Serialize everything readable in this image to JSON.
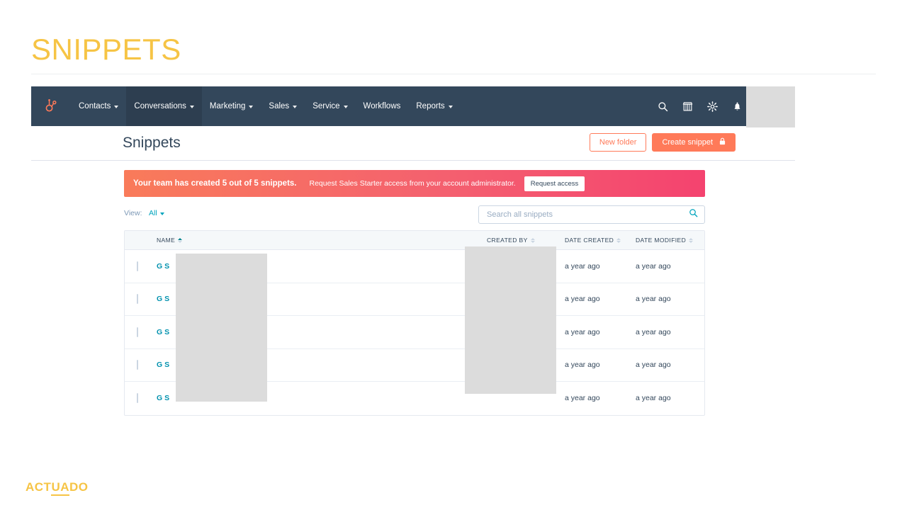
{
  "slide": {
    "title": "SNIPPETS",
    "footer_logo_part1": "ACT",
    "footer_logo_underlined": "UA",
    "footer_logo_part2": "DO",
    "accent_yellow": "#F6C445"
  },
  "topnav": {
    "logo_icon": "hubspot-sprocket-icon",
    "background": "#33475b",
    "items": [
      {
        "label": "Contacts",
        "has_caret": true,
        "active": false
      },
      {
        "label": "Conversations",
        "has_caret": true,
        "active": true
      },
      {
        "label": "Marketing",
        "has_caret": true,
        "active": false
      },
      {
        "label": "Sales",
        "has_caret": true,
        "active": false
      },
      {
        "label": "Service",
        "has_caret": true,
        "active": false
      },
      {
        "label": "Workflows",
        "has_caret": false,
        "active": false
      },
      {
        "label": "Reports",
        "has_caret": true,
        "active": false
      }
    ],
    "right_icons": [
      "search-icon",
      "marketplace-icon",
      "settings-gear-icon",
      "notifications-bell-icon"
    ]
  },
  "page_header": {
    "title": "Snippets",
    "new_folder_label": "New folder",
    "create_snippet_label": "Create snippet",
    "create_snippet_lock": "A",
    "primary_color": "#ff7a59"
  },
  "banner": {
    "headline": "Your team has created 5 out of 5 snippets.",
    "message": "Request Sales Starter access from your account administrator.",
    "button_label": "Request access",
    "gradient_from": "#f97b5a",
    "gradient_to": "#f4436f"
  },
  "filters": {
    "view_label": "View:",
    "view_value": "All",
    "search_placeholder": "Search all snippets",
    "search_value": "",
    "link_color": "#00a4bd"
  },
  "table": {
    "columns": [
      {
        "key": "name",
        "label": "NAME",
        "sorted": "asc"
      },
      {
        "key": "created_by",
        "label": "CREATED BY",
        "sorted": "none"
      },
      {
        "key": "date_created",
        "label": "DATE CREATED",
        "sorted": "none"
      },
      {
        "key": "date_modified",
        "label": "DATE MODIFIED",
        "sorted": "none"
      }
    ],
    "rows": [
      {
        "name": "G S",
        "created_by": "",
        "date_created": "a year ago",
        "date_modified": "a year ago"
      },
      {
        "name": "G S",
        "created_by": "",
        "date_created": "a year ago",
        "date_modified": "a year ago"
      },
      {
        "name": "G S",
        "created_by": "",
        "date_created": "a year ago",
        "date_modified": "a year ago"
      },
      {
        "name": "G S",
        "created_by": "",
        "date_created": "a year ago",
        "date_modified": "a year ago"
      },
      {
        "name": "G S",
        "created_by": "",
        "date_created": "a year ago",
        "date_modified": "a year ago"
      }
    ]
  }
}
